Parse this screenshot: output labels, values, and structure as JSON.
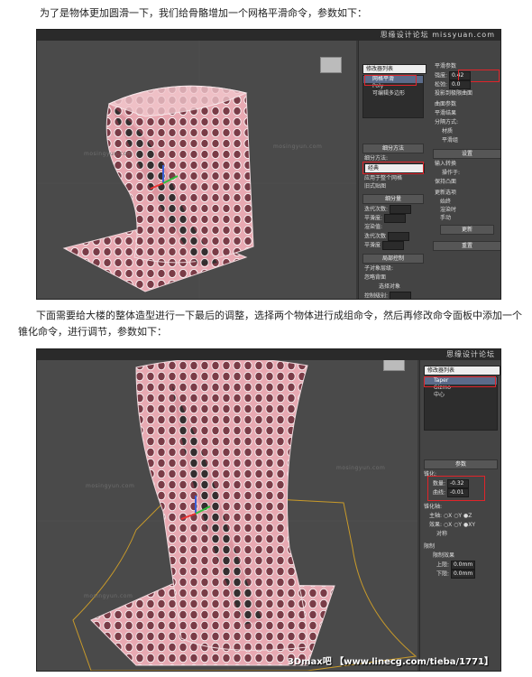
{
  "intro_text": "为了是物体更加圆滑一下，我们给骨骼增加一个网格平滑命令，参数如下：",
  "body_text": "下面需要给大楼的整体造型进行一下最后的调整，选择两个物体进行成组命令，然后再修改命令面板中添加一个锥化命令，进行调节，参数如下：",
  "screenshot1": {
    "brand": "思缘设计论坛",
    "watermark": "missyuan.com",
    "viewport_watermark": "mosingyun.com",
    "modifier_list_label": "修改器列表",
    "stack": [
      "网格平滑",
      "Poly",
      "可编辑多边形"
    ],
    "subdivision_method_header": "细分方法",
    "subdivision_method_label": "细分方法:",
    "subdivision_method_value": "经典",
    "apply_to_whole": "应用于整个网格",
    "old_style_mapping": "旧式贴图",
    "subdivision_amount_header": "细分量",
    "iterations_label": "迭代次数:",
    "smoothness_label": "平滑度:",
    "render_values_label": "渲染值:",
    "render_iterations_label": "迭代次数",
    "render_smoothness_label": "平滑度",
    "local_control_header": "局部控制",
    "subobject_level_label": "子对象层级:",
    "ignore_backfacing": "忽略背面",
    "object_selection": "选择对象",
    "control_level_label": "控制级别:",
    "smooth_params_header": "平滑参数",
    "strength_label": "强度:",
    "strength_value": "0.42",
    "relax_label": "松弛:",
    "relax_value": "0.0",
    "project_to_surface": "投影到极限曲面",
    "surface_params_header": "曲面参数",
    "smooth_result": "平滑结果",
    "separate_by": "分隔方式:",
    "by_material": "材质",
    "by_smoothing_group": "平滑组",
    "settings_header": "设置",
    "input_conversion": "输入转换",
    "operate_on": "操作于:",
    "keep_convex": "保持凸面",
    "update_options": "更新选项",
    "update_always": "始终",
    "update_render": "渲染时",
    "update_manual": "手动",
    "update_button": "更新",
    "reset_header": "重置"
  },
  "screenshot2": {
    "brand": "思缘设计论坛",
    "modifier_list_label": "修改器列表",
    "stack": [
      "Taper",
      "Gizmo",
      "中心"
    ],
    "params_header": "参数",
    "taper_group": "锥化:",
    "amount_label": "数量:",
    "amount_value": "-0.32",
    "curve_label": "曲线:",
    "curve_value": "-0.01",
    "taper_axis_group": "锥化轴:",
    "primary_label": "主轴:",
    "effect_label": "效果:",
    "symmetry_label": "对称",
    "limits_group": "限制",
    "limit_effect_label": "限制效果",
    "upper_limit_label": "上限:",
    "upper_limit_value": "0.0mm",
    "lower_limit_label": "下限:",
    "lower_limit_value": "0.0mm",
    "viewport_watermark": "mosingyun.com",
    "caption": "3Dmax吧 【www.linecg.com/tieba/1771】"
  },
  "colors": {
    "highlight": "#e0242a",
    "mesh_fill": "#e6a4ad",
    "mesh_wire": "#f4e6e8",
    "panel_bg": "#444444",
    "viewport_bg": "#4a4a4a"
  }
}
